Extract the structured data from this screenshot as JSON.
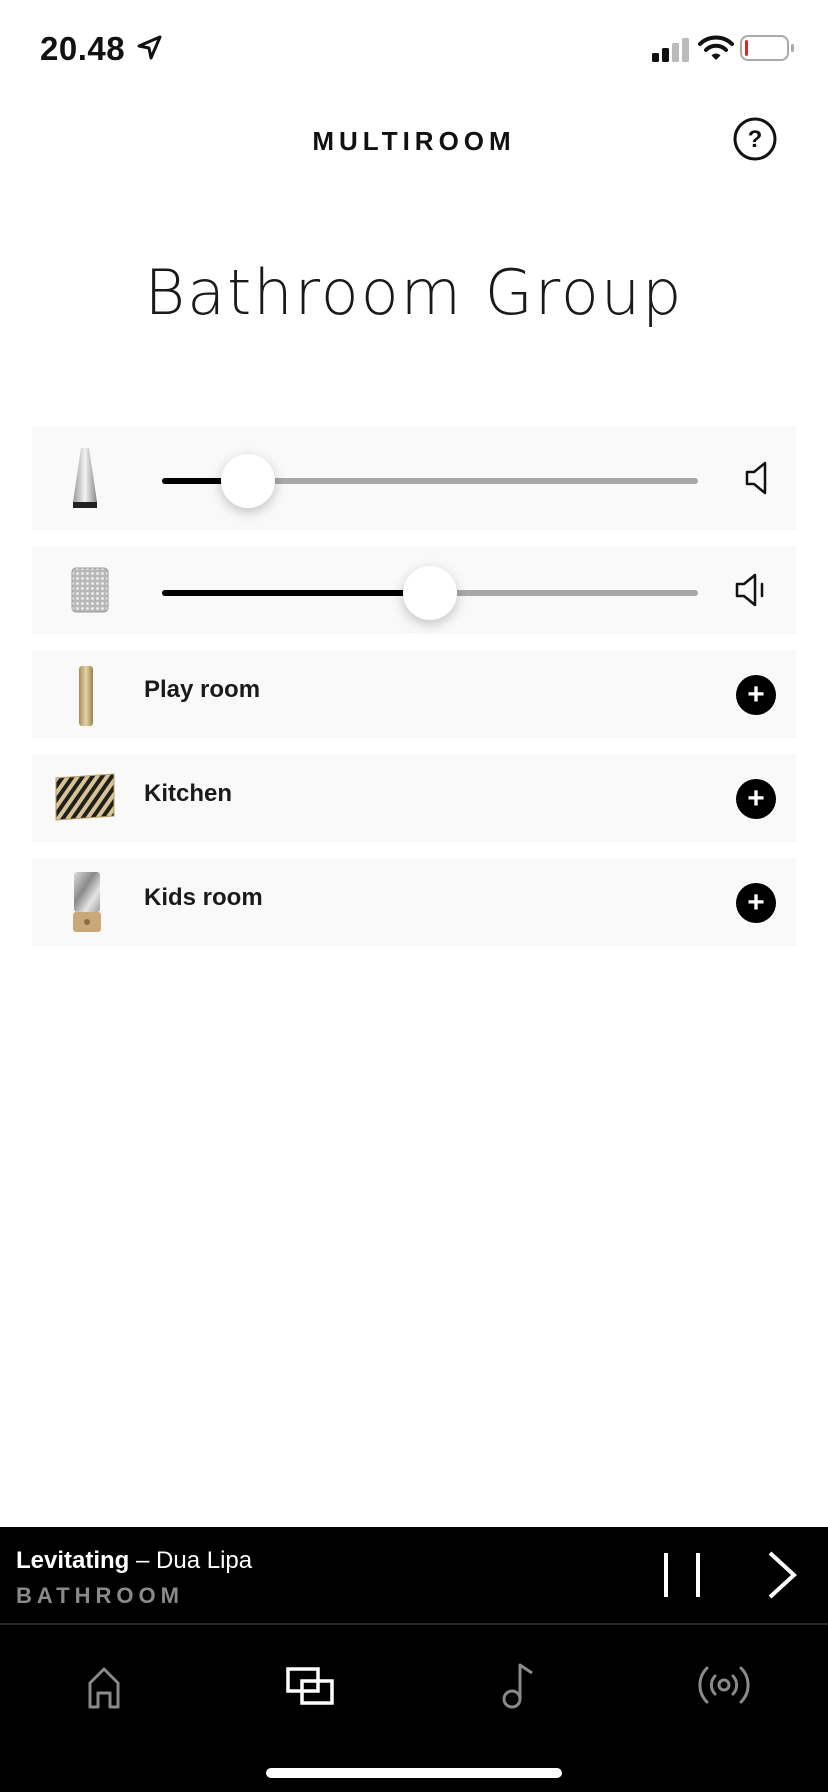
{
  "status_bar": {
    "time": "20.48",
    "icons": [
      "location-arrow-icon",
      "cellular-signal-icon",
      "wifi-icon",
      "battery-icon"
    ]
  },
  "header": {
    "title": "MULTIROOM",
    "help_icon": "question-circle-icon"
  },
  "group": {
    "title": "Bathroom Group",
    "speakers": [
      {
        "device": "cone-speaker",
        "volume": 0.16,
        "icon": "speaker-volume-icon"
      },
      {
        "device": "box-speaker",
        "volume": 0.5,
        "icon": "speaker-volume-icon"
      }
    ]
  },
  "rooms": [
    {
      "label": "Play room",
      "device": "tall-column-speaker",
      "action_icon": "plus-icon"
    },
    {
      "label": "Kitchen",
      "device": "striped-wall-speaker",
      "action_icon": "plus-icon"
    },
    {
      "label": "Kids room",
      "device": "marble-cylinder-speaker",
      "action_icon": "plus-icon"
    }
  ],
  "now_playing": {
    "song": "Levitating",
    "separator": " – ",
    "artist": "Dua Lipa",
    "room": "BATHROOM",
    "controls": [
      "pause-icon",
      "next-icon"
    ]
  },
  "tab_bar": {
    "tabs": [
      {
        "name": "home",
        "icon": "home-icon",
        "active": false
      },
      {
        "name": "multiroom",
        "icon": "multiroom-icon",
        "active": true
      },
      {
        "name": "music",
        "icon": "music-note-icon",
        "active": false
      },
      {
        "name": "radio",
        "icon": "radio-broadcast-icon",
        "active": false
      }
    ]
  },
  "colors": {
    "accent": "#000000",
    "card_bg": "#f9f9f9",
    "track": "#a8a8a8",
    "inactive_tab": "#8a8a8a",
    "room_label_dark": "#8a8a8a"
  }
}
